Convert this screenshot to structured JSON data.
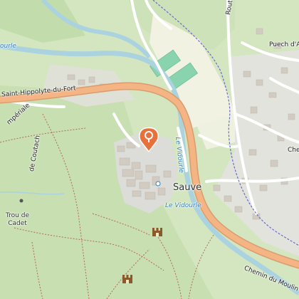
{
  "map": {
    "labels": {
      "main_road": "Saint-Hippolyte-du-Fort",
      "road_villesele": "Route de Villesèle",
      "road_moulin": "Chemin du Moulin Neuf",
      "road_coutach": "de Coutach",
      "road_imperiale": "mpériale",
      "river_vidourle_vertical": "Le Vidourle",
      "river_vidourle_lower": "Le Vidourle",
      "river_west": "ourle",
      "town": "Sauve",
      "puech": "Puech d'A",
      "poi_trou_line1": "Trou de",
      "poi_trou_line2": "Cadet",
      "edge_che": "Che"
    },
    "colors": {
      "main_road": "#f4b483",
      "main_road_casing": "#d99c6e",
      "river": "#aad3df",
      "forest": "#c9dfb4",
      "meadow": "#d9e8c3",
      "urban": "#e0e0e0",
      "building": "#cfc8be",
      "marker": "#e8703a",
      "sport_pitch": "#8ad3af",
      "trail": "#b56a5a",
      "footpath": "#f0d6b8",
      "boundary": "#6a6ad0"
    },
    "icons": [
      "location-marker-icon",
      "castle-ruin-icon",
      "castle-ruin-icon"
    ]
  }
}
